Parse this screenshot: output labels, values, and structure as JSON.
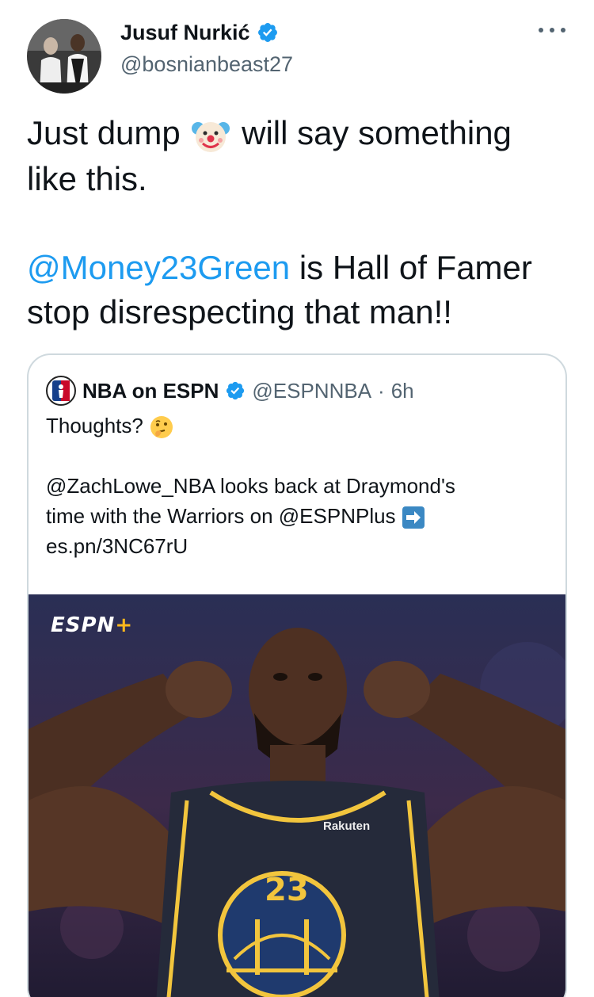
{
  "author": {
    "name": "Jusuf Nurkić",
    "handle": "@bosnianbeast27"
  },
  "tweet": {
    "line1_before": "Just dump",
    "line1_after": "will say something",
    "line2": "like this.",
    "mention": "@Money23Green",
    "line3_rest": " is Hall of Famer",
    "line4": "stop disrespecting that man!!"
  },
  "quoted": {
    "name": "NBA on ESPN",
    "handle": "@ESPNNBA",
    "separator": "·",
    "time": "6h",
    "text_line1": "Thoughts?",
    "text_line2": "@ZachLowe_NBA looks back at Draymond's",
    "text_line3": "time with the Warriors on @ESPNPlus",
    "link": "es.pn/3NC67rU"
  },
  "media": {
    "logo": "ESPN",
    "logo_plus": "+",
    "sponsor": "Rakuten",
    "jersey_number": "23"
  },
  "icons": {
    "verified": "verified-badge-icon",
    "more": "more-icon",
    "clown": "clown-emoji-icon",
    "thinking": "thinking-emoji-icon",
    "arrow": "right-arrow-emoji-icon"
  },
  "colors": {
    "accent": "#1d9bf0",
    "text": "#0f1419",
    "muted": "#536471",
    "border": "#cfd9de"
  }
}
